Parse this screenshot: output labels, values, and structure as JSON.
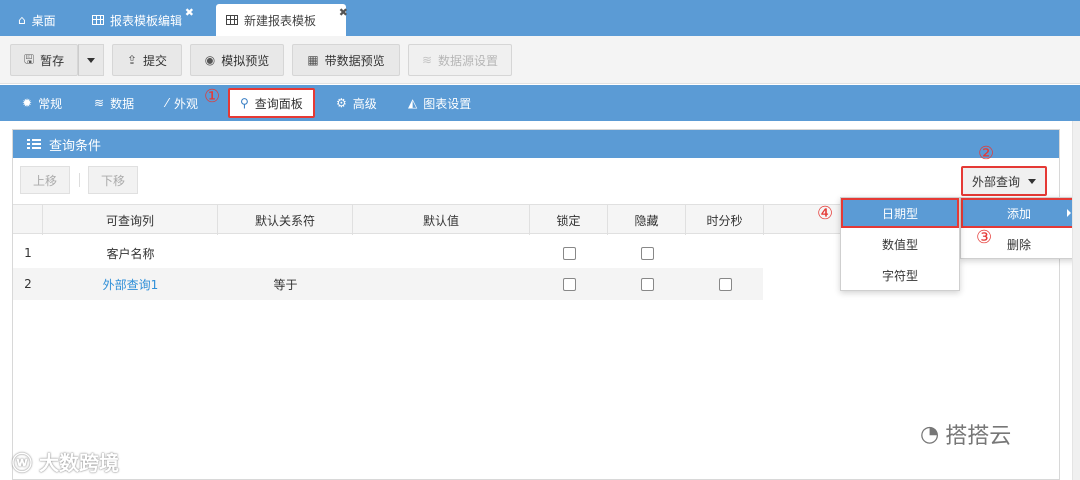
{
  "tabs": [
    {
      "label": "桌面",
      "icon": "home-icon"
    },
    {
      "label": "报表模板编辑",
      "icon": "grid-icon"
    },
    {
      "label": "新建报表模板",
      "icon": "grid-icon"
    }
  ],
  "toolbar": {
    "save": "暂存",
    "submit": "提交",
    "sim_preview": "模拟预览",
    "data_preview": "带数据预览",
    "datasource": "数据源设置"
  },
  "subnav": {
    "general": "常规",
    "data": "数据",
    "appearance": "外观",
    "query_panel": "查询面板",
    "advanced": "高级",
    "chart": "图表设置"
  },
  "panel": {
    "title": "查询条件",
    "move_up": "上移",
    "move_down": "下移",
    "external_query": "外部查询"
  },
  "table": {
    "headers": [
      "可查询列",
      "默认关系符",
      "默认值",
      "锁定",
      "隐藏",
      "时分秒"
    ],
    "rows": [
      {
        "no": "1",
        "column": "客户名称",
        "relation": "",
        "value": "",
        "locked": false,
        "hidden": false
      },
      {
        "no": "2",
        "column": "外部查询1",
        "relation": "等于",
        "value": "",
        "locked": false,
        "hidden": false,
        "hms": false
      }
    ]
  },
  "menu_main": {
    "add": "添加",
    "delete": "删除"
  },
  "menu_sub": {
    "date": "日期型",
    "number": "数值型",
    "string": "字符型"
  },
  "markers": [
    "①",
    "②",
    "③",
    "④"
  ],
  "watermark": {
    "left": "大数跨境",
    "right": "搭搭云"
  },
  "colors": {
    "accent": "#5b9bd5",
    "highlight": "#e53935",
    "link": "#2f8fd8"
  }
}
